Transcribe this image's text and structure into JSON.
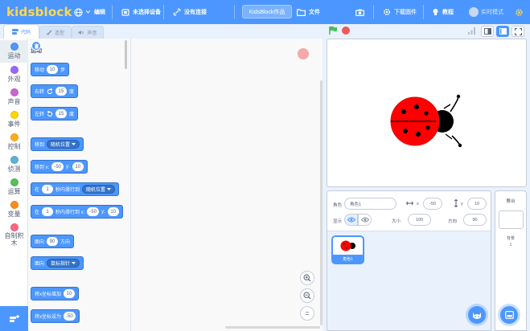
{
  "app": {
    "logo": "kidsblock",
    "brand_color": "#4c97ff",
    "logo_color": "#ffd84d"
  },
  "menubar": {
    "language_icon": "globe-icon",
    "edit_label": "编辑",
    "device_label": "未选择设备",
    "connect_label": "没有连接",
    "project_title": "KidsBlock作品",
    "file_label": "文件",
    "download_label": "下载固件",
    "tutorial_label": "教程",
    "realtime_label": "实时模式"
  },
  "tabs": [
    {
      "label": "代码",
      "icon": "code-icon"
    },
    {
      "label": "造型",
      "icon": "brush-icon"
    },
    {
      "label": "声音",
      "icon": "speaker-icon"
    }
  ],
  "categories": [
    {
      "label": "运动",
      "color": "#4c97ff"
    },
    {
      "label": "外观",
      "color": "#9966ff"
    },
    {
      "label": "声音",
      "color": "#cf63cf"
    },
    {
      "label": "事件",
      "color": "#ffd500"
    },
    {
      "label": "控制",
      "color": "#ffab19"
    },
    {
      "label": "侦测",
      "color": "#5cb1d6"
    },
    {
      "label": "运算",
      "color": "#59c059"
    },
    {
      "label": "变量",
      "color": "#ff8c1a"
    },
    {
      "label": "自制积木",
      "color": "#ff6680"
    }
  ],
  "palette": {
    "heading": "运动",
    "move": {
      "label": "移动",
      "value": "10",
      "suffix": "步"
    },
    "turn_right": {
      "label": "右转",
      "value": "15",
      "suffix": "度"
    },
    "turn_left": {
      "label": "左转",
      "value": "15",
      "suffix": "度"
    },
    "goto": {
      "label": "移到",
      "option": "随机位置"
    },
    "goto_xy": {
      "label": "移到 x:",
      "x": "-50",
      "ylabel": "y:",
      "y": "10"
    },
    "glide": {
      "prefix": "在",
      "value": "1",
      "label": "秒内滑行到",
      "option": "随机位置"
    },
    "glide_xy": {
      "prefix": "在",
      "value": "1",
      "label": "秒内滑行到 x:",
      "x": "-50",
      "ylabel": "y:",
      "y": "10"
    },
    "point_dir": {
      "label": "面向",
      "value": "90",
      "suffix": "方向"
    },
    "point_towards": {
      "label": "面向",
      "option": "鼠标指针"
    },
    "change_x": {
      "label": "将x坐标增加",
      "value": "10"
    },
    "set_x": {
      "label": "将x坐标设为",
      "value": "-50"
    }
  },
  "zoom": {
    "in": "+",
    "out": "−",
    "reset": "="
  },
  "sprite_info": {
    "sprite_label": "角色",
    "sprite_name": "角色1",
    "x_label": "x",
    "x_value": "-50",
    "y_label": "y",
    "y_value": "10",
    "show_label": "显示",
    "size_label": "大小",
    "size_value": "100",
    "direction_label": "方向",
    "direction_value": "90"
  },
  "sprite_list": [
    {
      "name": "角色1"
    }
  ],
  "stage_pane": {
    "title": "舞台",
    "backdrops_label": "背景",
    "backdrops_count": "1"
  }
}
